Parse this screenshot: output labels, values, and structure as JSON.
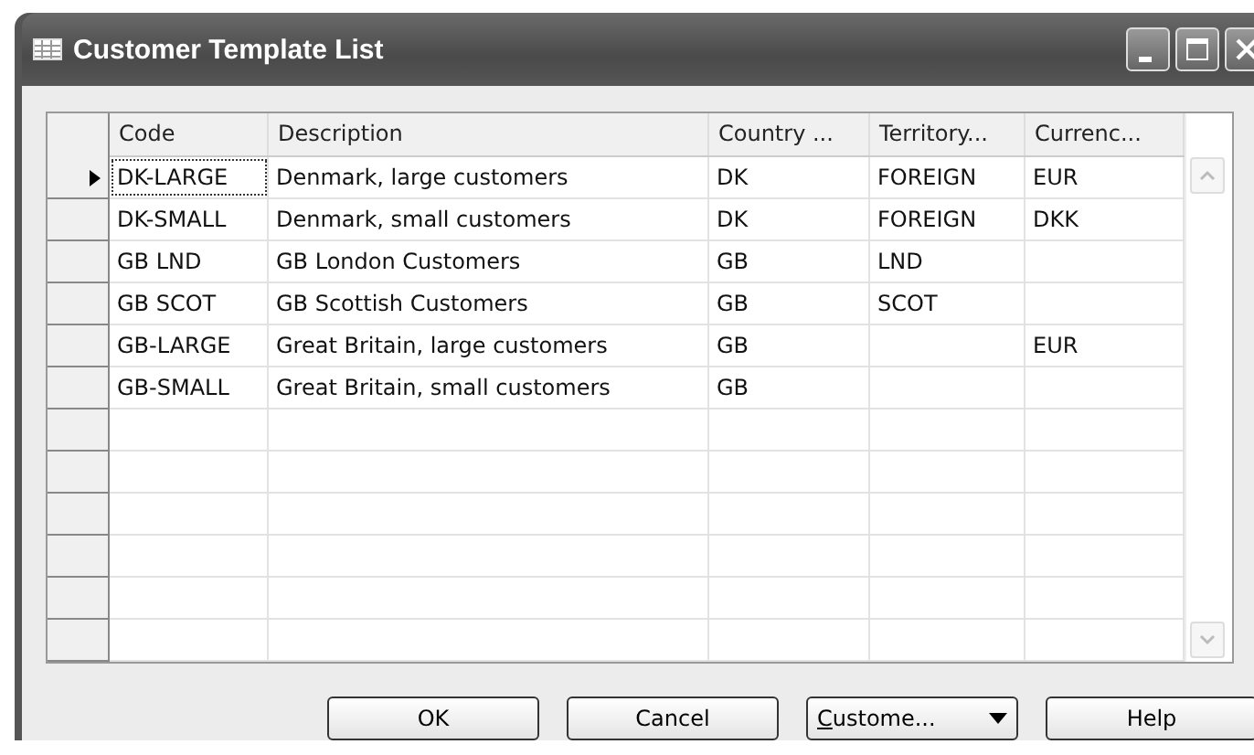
{
  "window": {
    "title": "Customer Template List"
  },
  "table": {
    "columns": [
      "Code",
      "Description",
      "Country ...",
      "Territory...",
      "Currenc..."
    ],
    "rows": [
      {
        "selected": true,
        "cells": [
          "DK-LARGE",
          "Denmark, large customers",
          "DK",
          "FOREIGN",
          "EUR"
        ]
      },
      {
        "selected": false,
        "cells": [
          "DK-SMALL",
          "Denmark, small customers",
          "DK",
          "FOREIGN",
          "DKK"
        ]
      },
      {
        "selected": false,
        "cells": [
          "GB LND",
          "GB London Customers",
          "GB",
          "LND",
          ""
        ]
      },
      {
        "selected": false,
        "cells": [
          "GB SCOT",
          "GB Scottish Customers",
          "GB",
          "SCOT",
          ""
        ]
      },
      {
        "selected": false,
        "cells": [
          "GB-LARGE",
          "Great Britain, large customers",
          "GB",
          "",
          "EUR"
        ]
      },
      {
        "selected": false,
        "cells": [
          "GB-SMALL",
          "Great Britain, small customers",
          "GB",
          "",
          ""
        ]
      }
    ]
  },
  "buttons": [
    {
      "kind": "button",
      "label": "OK"
    },
    {
      "kind": "button",
      "label": "Cancel"
    },
    {
      "kind": "menu",
      "label": "Custome..."
    },
    {
      "kind": "button",
      "label": "Help"
    }
  ]
}
